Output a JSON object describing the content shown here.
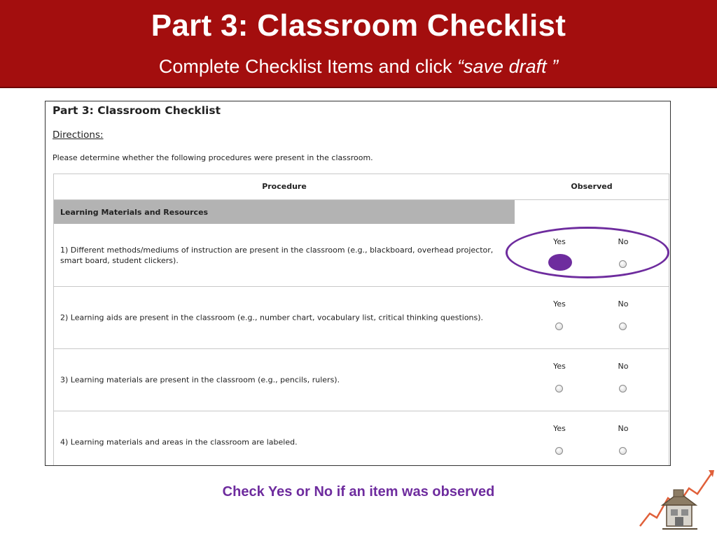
{
  "slide": {
    "title": "Part 3: Classroom Checklist",
    "subtitle_prefix": "Complete Checklist Items and click ",
    "subtitle_emphasis": "“save draft ”",
    "footer_note": "Check Yes or No if an item was observed",
    "accent_color": "#6e2c9e",
    "banner_color": "#a30e0e"
  },
  "form": {
    "title": "Part 3: Classroom Checklist",
    "directions_label": "Directions:",
    "instructions": "Please determine whether the following procedures were present in the classroom.",
    "columns": {
      "procedure": "Procedure",
      "observed": "Observed"
    },
    "section": "Learning Materials and Resources",
    "yes_label": "Yes",
    "no_label": "No",
    "items": [
      {
        "text": "1) Different methods/mediums of instruction are present in the classroom (e.g., blackboard, overhead projector, smart board, student clickers).",
        "highlighted": true
      },
      {
        "text": "2) Learning aids are present in the classroom (e.g., number chart, vocabulary list, critical thinking questions).",
        "highlighted": false
      },
      {
        "text": "3) Learning materials are present in the classroom (e.g., pencils, rulers).",
        "highlighted": false
      },
      {
        "text": "4) Learning materials and areas in the classroom are labeled.",
        "highlighted": false
      }
    ]
  },
  "logo": {
    "icon": "house-growth-chart-icon"
  }
}
